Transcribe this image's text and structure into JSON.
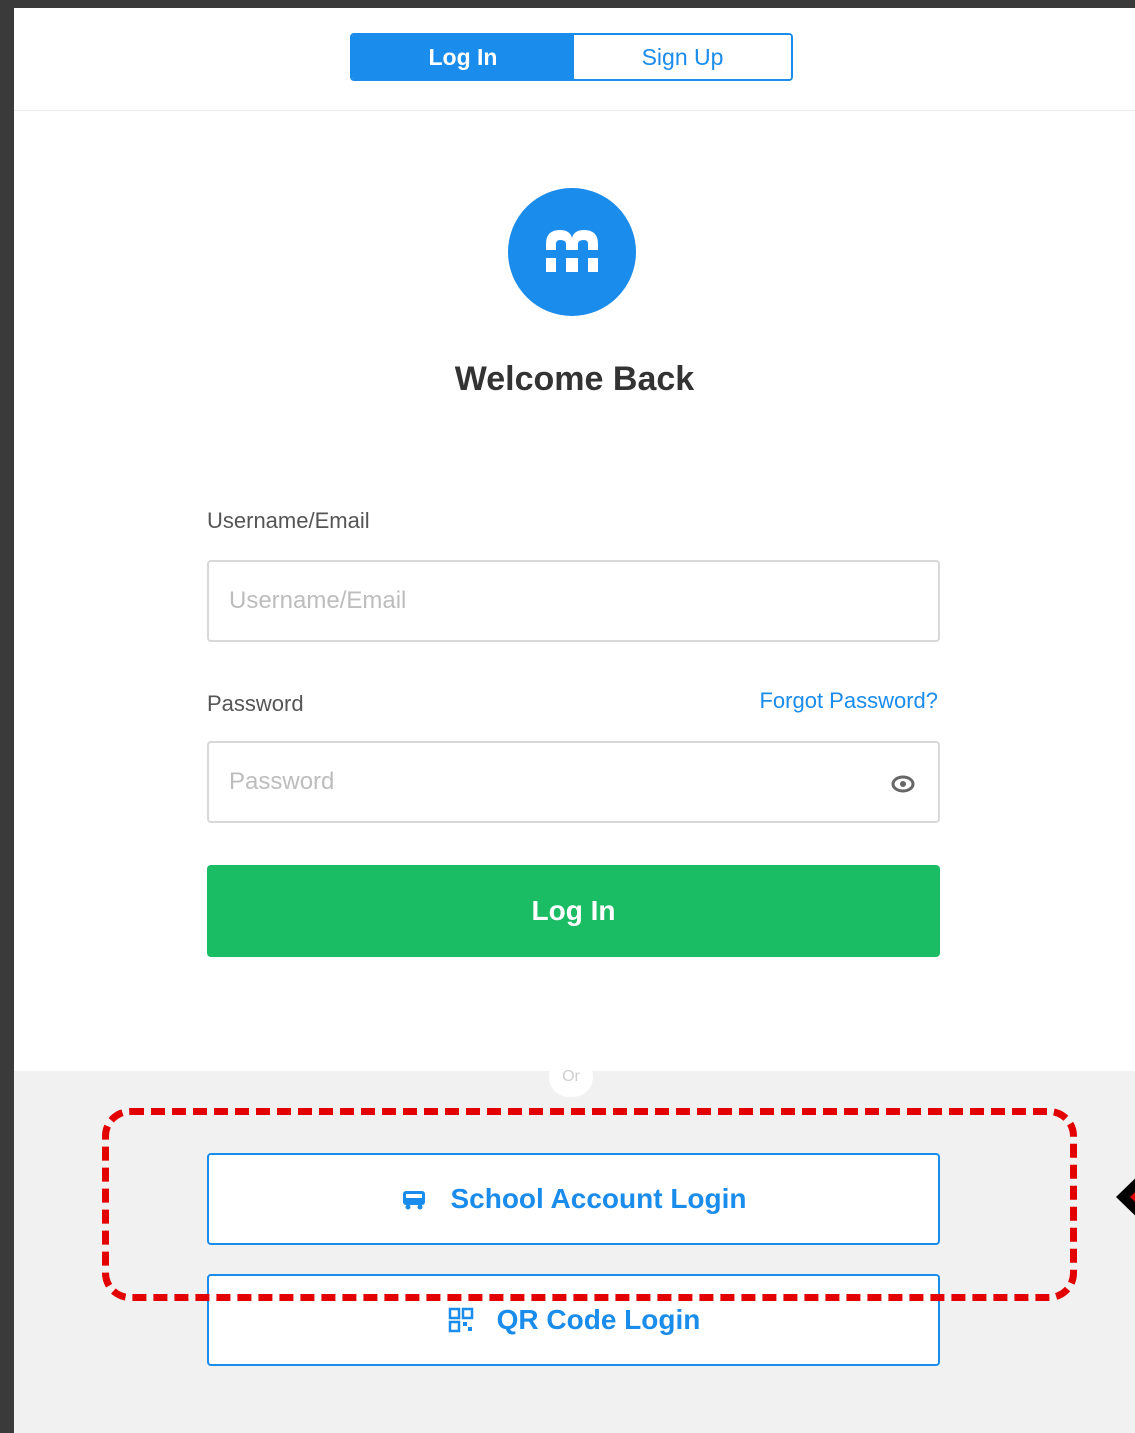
{
  "tabs": {
    "login_label": "Log In",
    "signup_label": "Sign Up"
  },
  "welcome": "Welcome Back",
  "username": {
    "label": "Username/Email",
    "placeholder": "Username/Email",
    "value": ""
  },
  "password": {
    "label": "Password",
    "placeholder": "Password",
    "value": "",
    "forgot_label": "Forgot Password?"
  },
  "login_button": "Log In",
  "divider": "Or",
  "alt_logins": {
    "school_label": "School Account Login",
    "qr_label": "QR Code Login"
  },
  "icons": {
    "logo": "m-logo-icon",
    "eye": "eye-icon",
    "school": "school-bus-icon",
    "qr": "qr-code-icon"
  },
  "colors": {
    "primary": "#1a8cec",
    "login_green": "#1bbd64",
    "annotation_red": "#e30000"
  }
}
